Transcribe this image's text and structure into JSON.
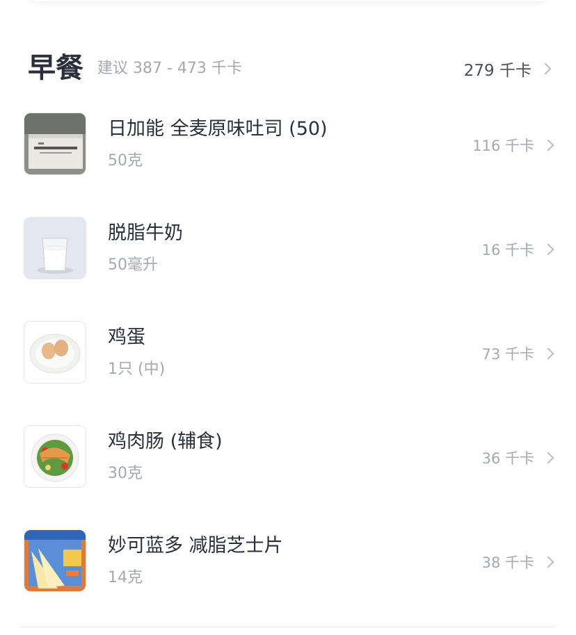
{
  "meal": {
    "title": "早餐",
    "suggestion": "建议 387 - 473 千卡",
    "total": "279 千卡"
  },
  "foods": [
    {
      "name": "日加能 全麦原味吐司 (50)",
      "amount": "50克",
      "calories": "116 千卡",
      "thumb": "bread-package-photo"
    },
    {
      "name": "脱脂牛奶",
      "amount": "50毫升",
      "calories": "16 千卡",
      "thumb": "milk-glass-photo"
    },
    {
      "name": "鸡蛋",
      "amount": "1只 (中)",
      "calories": "73 千卡",
      "thumb": "eggs-plate-photo"
    },
    {
      "name": "鸡肉肠 (辅食)",
      "amount": "30克",
      "calories": "36 千卡",
      "thumb": "chicken-salad-photo"
    },
    {
      "name": "妙可蓝多 减脂芝士片",
      "amount": "14克",
      "calories": "38 千卡",
      "thumb": "cheese-slices-package-photo"
    }
  ]
}
